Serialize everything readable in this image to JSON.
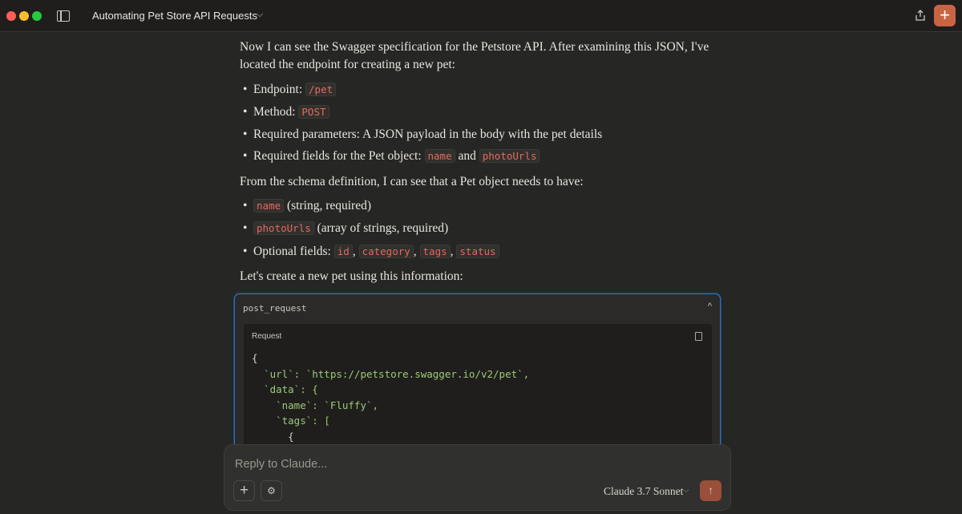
{
  "window": {
    "title": "Automating Pet Store API Requests",
    "title_chevron": "⌵",
    "new_chat_label": "+"
  },
  "message": {
    "intro": "Now I can see the Swagger specification for the Petstore API. After examining this JSON, I've located the endpoint for creating a new pet:",
    "endpoint_label": "Endpoint:",
    "endpoint_value": "/pet",
    "method_label": "Method:",
    "method_value": "POST",
    "required_params": "Required parameters: A JSON payload in the body with the pet details",
    "required_fields_label": "Required fields for the Pet object:",
    "required_fields_1": "name",
    "required_fields_and": "and",
    "required_fields_2": "photoUrls",
    "schema_intro": "From the schema definition, I can see that a Pet object needs to have:",
    "field_name": "name",
    "field_name_desc": "(string, required)",
    "field_photo": "photoUrls",
    "field_photo_desc": "(array of strings, required)",
    "optional_label": "Optional fields:",
    "optional": [
      "id",
      "category",
      "tags",
      "status"
    ],
    "outro": "Let's create a new pet using this information:"
  },
  "tool": {
    "name": "post_request",
    "request_label": "Request",
    "code_lines": [
      "{",
      "  `url`: `https://petstore.swagger.io/v2/pet`,",
      "  `data`: {",
      "    `name`: `Fluffy`,",
      "    `tags`: [",
      "      {"
    ]
  },
  "reply": {
    "placeholder": "Reply to Claude...",
    "model": "Claude 3.7 Sonnet",
    "model_chevron": "⌵",
    "plus_label": "+",
    "settings_label": "⚙",
    "send_label": "↑"
  },
  "colors": {
    "accent": "#c96442",
    "code_inline": "#e46a5f",
    "focus_border": "#2f6fb5"
  }
}
